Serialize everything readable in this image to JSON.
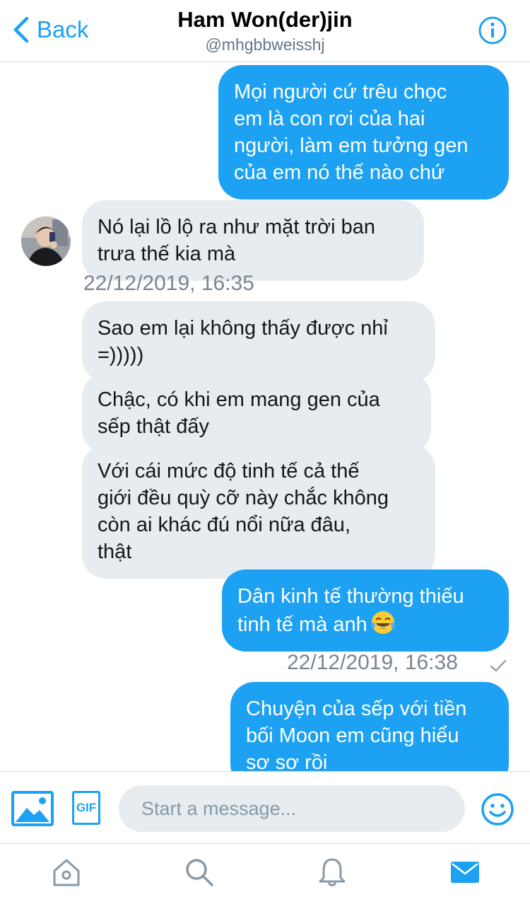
{
  "header": {
    "back_label": "Back",
    "title": "Ham Won(der)jin",
    "handle": "@mhgbbweisshj"
  },
  "messages": [
    {
      "from": "me",
      "text": "Mọi người cứ trêu chọc\nem là con rơi của hai\nngười, làm em tưởng gen\ncủa em nó thế nào chứ"
    },
    {
      "from": "them",
      "text": "Nó lại lồ lộ ra như mặt trời ban\ntrưa thế kia mà"
    },
    {
      "from": "them",
      "text": "Sao em lại không thấy được nhỉ\n=)))))"
    },
    {
      "from": "them",
      "text": "Chậc, có khi em mang gen của\nsếp thật đấy"
    },
    {
      "from": "them",
      "text": "Với cái mức độ tinh tế cả thế\ngiới đều quỳ cỡ này chắc không\ncòn ai khác đú nổi nữa đâu,\nthật"
    },
    {
      "from": "me",
      "text": "Dân kinh tế thường thiếu\ntinh tế mà anh",
      "emoji": "laughing-tears"
    },
    {
      "from": "me",
      "text": "Chuyện của sếp với tiền\nbối Moon em cũng hiểu\nsơ sơ rồi"
    }
  ],
  "timestamps": {
    "them": "22/12/2019, 16:35",
    "me": "22/12/2019, 16:38"
  },
  "compose": {
    "placeholder": "Start a message...",
    "gif_label": "GIF"
  },
  "tabs": [
    {
      "icon": "home-icon"
    },
    {
      "icon": "search-icon"
    },
    {
      "icon": "notifications-icon"
    },
    {
      "icon": "messages-icon",
      "active": true
    }
  ],
  "colors": {
    "accent": "#1da1f2",
    "incoming_bubble": "#e6ecf0",
    "outgoing_bubble": "#1da1f2",
    "timestamp": "#7a8590"
  }
}
